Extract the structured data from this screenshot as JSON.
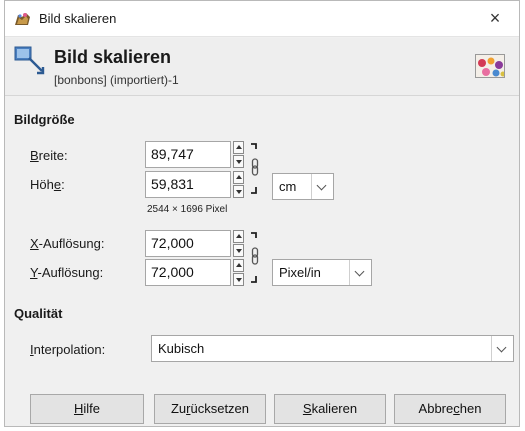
{
  "window": {
    "title": "Bild skalieren",
    "close_glyph": "×"
  },
  "header": {
    "title": "Bild skalieren",
    "subtitle": "[bonbons] (importiert)-1"
  },
  "image_size": {
    "section_title": "Bildgröße",
    "width_label_u": "B",
    "width_label_rest": "reite:",
    "width_value": "89,747",
    "height_label_pre": "Höh",
    "height_label_u": "e",
    "height_label_post": ":",
    "height_value": "59,831",
    "unit": "cm",
    "pixel_info": "2544 × 1696 Pixel",
    "xres_label_u": "X",
    "xres_label_rest": "-Auflösung:",
    "xres_value": "72,000",
    "yres_label_u": "Y",
    "yres_label_rest": "-Auflösung:",
    "yres_value": "72,000",
    "res_unit": "Pixel/in"
  },
  "quality": {
    "section_title": "Qualität",
    "interp_label_u": "I",
    "interp_label_rest": "nterpolation:",
    "interp_value": "Kubisch"
  },
  "buttons": {
    "help_u": "H",
    "help_rest": "ilfe",
    "reset_pre": "Zu",
    "reset_u": "r",
    "reset_post": "ücksetzen",
    "scale_u": "S",
    "scale_rest": "kalieren",
    "cancel_pre": "Abbre",
    "cancel_u": "c",
    "cancel_post": "hen"
  },
  "icons": {
    "app": "gimp-scale-icon",
    "header": "scale-image-icon",
    "thumbnail": "image-thumbnail",
    "chain": "chain-link-icon"
  }
}
